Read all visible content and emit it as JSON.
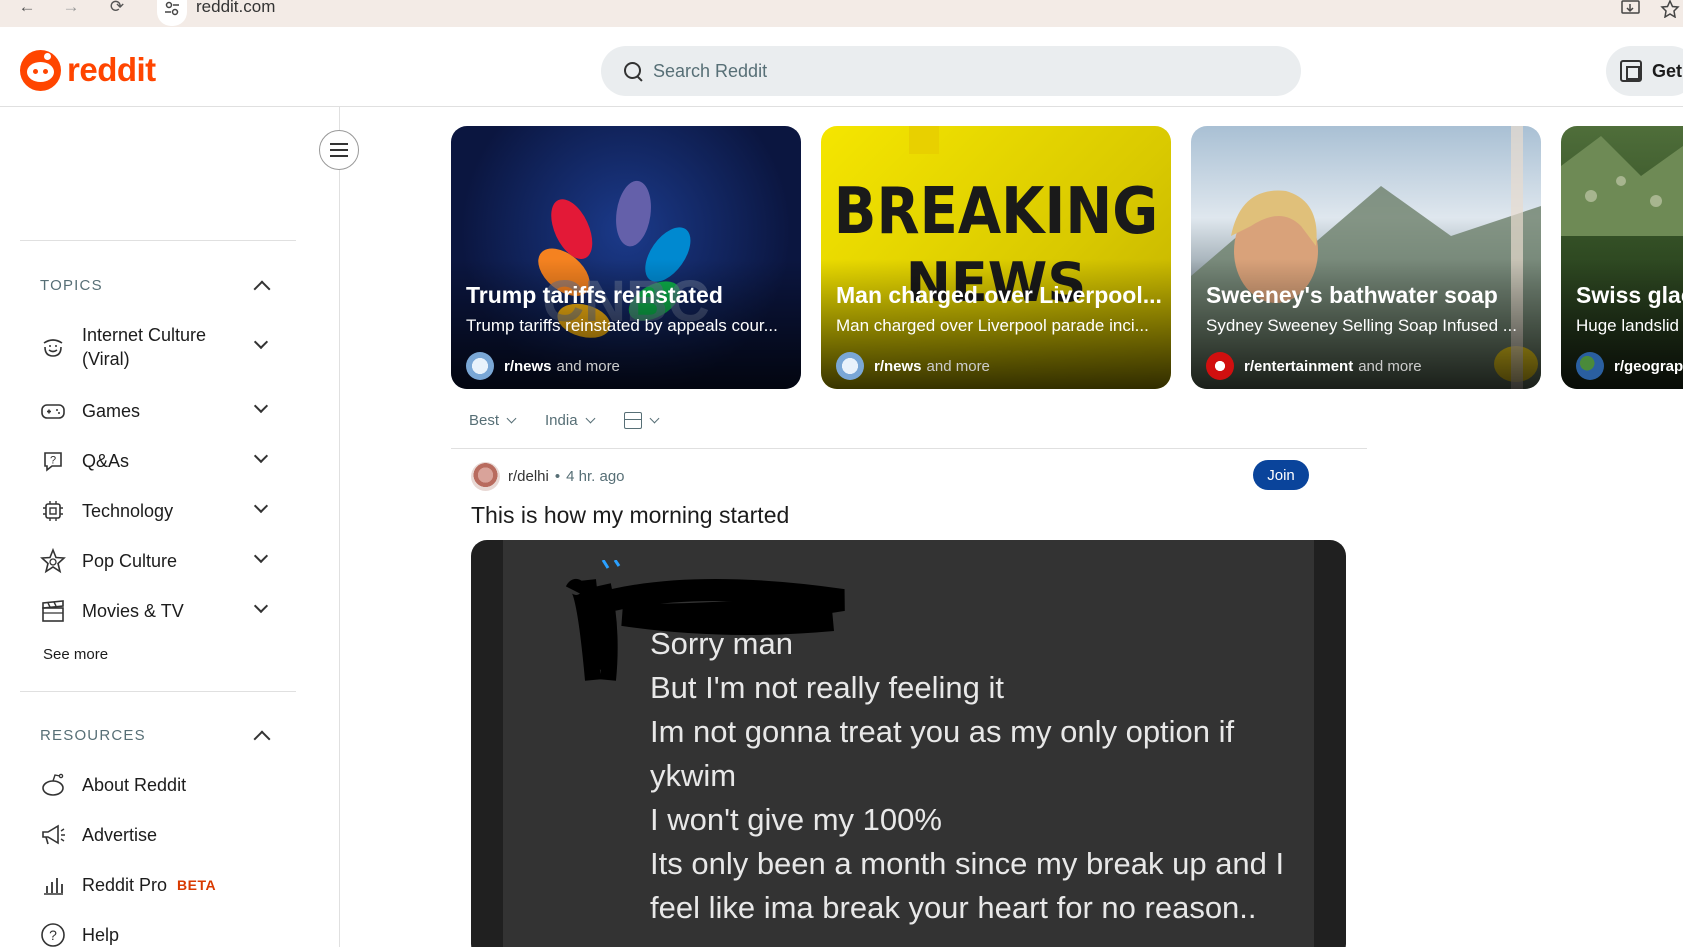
{
  "browser": {
    "url": "reddit.com",
    "back_icon": "←",
    "forward_icon": "→",
    "reload_icon": "⟳"
  },
  "header": {
    "logo_text": "reddit",
    "search_placeholder": "Search Reddit",
    "get_app_label": "Get"
  },
  "sidebar": {
    "topics_title": "TOPICS",
    "topics": [
      {
        "label": "Internet Culture (Viral)",
        "icon": "smile-icon"
      },
      {
        "label": "Games",
        "icon": "gamepad-icon"
      },
      {
        "label": "Q&As",
        "icon": "question-bubble-icon"
      },
      {
        "label": "Technology",
        "icon": "chip-icon"
      },
      {
        "label": "Pop Culture",
        "icon": "star-icon"
      },
      {
        "label": "Movies & TV",
        "icon": "clapperboard-icon"
      }
    ],
    "see_more": "See more",
    "resources_title": "RESOURCES",
    "resources": [
      {
        "label": "About Reddit",
        "icon": "reddit-alien-icon"
      },
      {
        "label": "Advertise",
        "icon": "megaphone-icon"
      },
      {
        "label": "Reddit Pro",
        "badge": "BETA",
        "icon": "bar-chart-icon"
      },
      {
        "label": "Help",
        "icon": "help-circle-icon"
      }
    ]
  },
  "trending": [
    {
      "title": "Trump tariffs reinstated",
      "subtitle": "Trump tariffs reinstated by appeals cour...",
      "subreddit": "r/news",
      "more": "and more",
      "bg": "#0d1a4a"
    },
    {
      "title": "Man charged over Liverpool...",
      "subtitle": "Man charged over Liverpool parade inci...",
      "subreddit": "r/news",
      "more": "and more",
      "bg": "#e6d800"
    },
    {
      "title": "Sweeney's bathwater soap",
      "subtitle": "Sydney Sweeney Selling Soap Infused ...",
      "subreddit": "r/entertainment",
      "more": "and more",
      "bg": "#8ca3b5"
    },
    {
      "title": "Swiss glac",
      "subtitle": "Huge landslid",
      "subreddit": "r/geograp",
      "more": "",
      "bg": "#3d5a2a"
    }
  ],
  "feed": {
    "sort_label": "Best",
    "region_label": "India"
  },
  "post": {
    "subreddit": "r/delhi",
    "separator": "•",
    "time": "4 hr. ago",
    "join_label": "Join",
    "title": "This is how my morning started",
    "image_text": [
      "Sorry man",
      "But I'm not really feeling it",
      "Im not gonna treat you as my only option if",
      "ykwim",
      "I won't give my 100%",
      "Its only been a month since my break up and I",
      "feel like ima break your heart for no reason.."
    ]
  },
  "colors": {
    "brand": "#ff4500",
    "join": "#0a449b",
    "beta": "#d93a00"
  }
}
